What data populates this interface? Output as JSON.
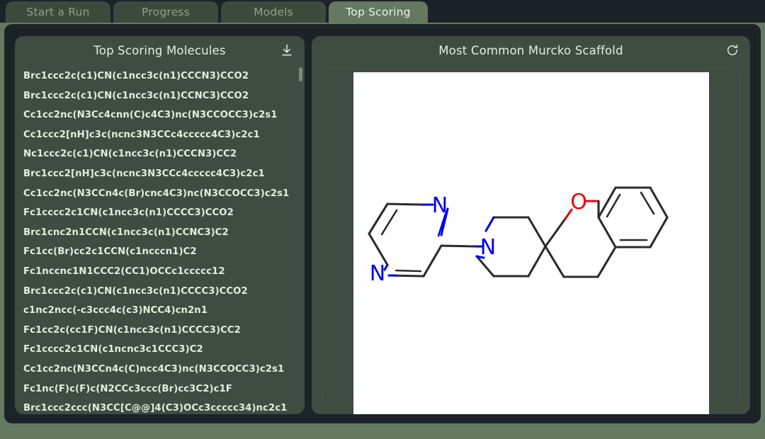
{
  "tabs": [
    {
      "label": "Start a Run",
      "active": false
    },
    {
      "label": "Progress",
      "active": false
    },
    {
      "label": "Models",
      "active": false
    },
    {
      "label": "Top Scoring",
      "active": true
    }
  ],
  "left_panel": {
    "title": "Top Scoring Molecules",
    "download_icon": "download-icon",
    "molecules": [
      "Brc1ccc2c(c1)CN(c1ncc3c(n1)CCCN3)CCO2",
      "Brc1ccc2c(c1)CN(c1ncc3c(n1)CCNC3)CCO2",
      "Cc1cc2nc(N3Cc4cnn(C)c4C3)nc(N3CCOCC3)c2s1",
      "Cc1ccc2[nH]c3c(ncnc3N3CCc4ccccc4C3)c2c1",
      "Nc1ccc2c(c1)CN(c1ncc3c(n1)CCCN3)CC2",
      "Brc1ccc2[nH]c3c(ncnc3N3CCc4ccccc4C3)c2c1",
      "Cc1cc2nc(N3CCn4c(Br)cnc4C3)nc(N3CCOCC3)c2s1",
      "Fc1cccc2c1CN(c1ncc3c(n1)CCCC3)CCO2",
      "Brc1cnc2n1CCN(c1ncc3c(n1)CCNC3)C2",
      "Fc1cc(Br)cc2c1CCN(c1ncccn1)C2",
      "Fc1nccnc1N1CCC2(CC1)OCCc1ccccc12",
      "Brc1ccc2c(c1)CN(c1ncc3c(n1)CCCC3)CCO2",
      "c1nc2ncc(-c3ccc4c(c3)NCC4)cn2n1",
      "Fc1cc2c(cc1F)CN(c1ncc3c(n1)CCCC3)CC2",
      "Fc1cccc2c1CN(c1ncnc3c1CCC3)C2",
      "Cc1cc2nc(N3CCn4c(C)ncc4C3)nc(N3CCOCC3)c2s1",
      "Fc1nc(F)c(F)c(N2CCc3ccc(Br)cc3C2)c1F",
      "Brc1ccc2ccc(N3CC[C@@]4(C3)OCc3ccccc34)nc2c1"
    ],
    "scroll_position": "top"
  },
  "right_panel": {
    "title": "Most Common Murcko Scaffold",
    "refresh_icon": "refresh-icon",
    "molecule_image": {
      "alt": "murcko-scaffold-structure",
      "background": "#ffffff",
      "atom_labels": [
        {
          "symbol": "N",
          "color": "#0000ee"
        },
        {
          "symbol": "N",
          "color": "#0000ee"
        },
        {
          "symbol": "N",
          "color": "#0000ee"
        },
        {
          "symbol": "O",
          "color": "#ee0000"
        }
      ],
      "bond_color": "#2b2b2b"
    }
  },
  "colors": {
    "window_background": "#64795f",
    "shell_background": "#1b2327",
    "panel_background": "#3e4c41",
    "tab_active_background": "#64795f",
    "tab_inactive_background": "#3c4a3d",
    "text_primary": "#dff3e2",
    "text_muted": "#8ea38c",
    "list_text": "#dff0dd",
    "nitrogen_blue": "#0000ee",
    "oxygen_red": "#ee0000"
  }
}
